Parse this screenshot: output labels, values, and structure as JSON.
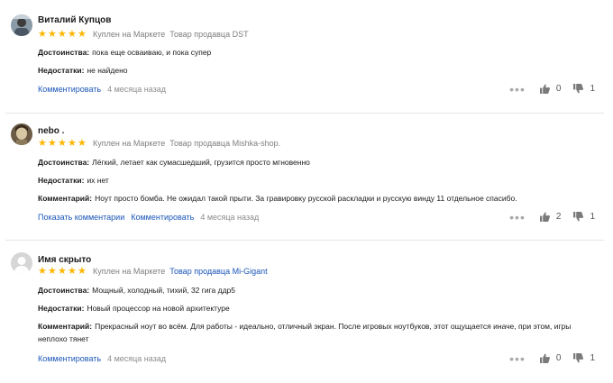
{
  "colors": {
    "star": "#fdb600",
    "link": "#1b56b8",
    "muted": "#8c8c8c"
  },
  "icons": {
    "more": "more-dots-icon",
    "like": "thumb-up-icon",
    "dislike": "thumb-down-icon",
    "rating": "star-icon"
  },
  "reviews": [
    {
      "author": "Виталий Купцов",
      "rating": 5,
      "purchase": "Куплен на Маркете",
      "seller": "Товар продавца DST",
      "pros_label": "Достоинства:",
      "pros": "пока еще осваиваю, и пока супер",
      "cons_label": "Недостатки:",
      "cons": "не найдено",
      "comment_action": "Комментировать",
      "date": "4 месяца назад",
      "likes": "0",
      "dislikes": "1"
    },
    {
      "author": "nebo .",
      "rating": 5,
      "purchase": "Куплен на Маркете",
      "seller": "Товар продавца Mishka-shop.",
      "pros_label": "Достоинства:",
      "pros": "Лёгкий, летает как сумасшедший, грузится просто мгновенно",
      "cons_label": "Недостатки:",
      "cons": "их нет",
      "comment_label": "Комментарий:",
      "comment": "Ноут просто бомба. Не ожидал такой прыти. За гравировку русской раскладки и русскую винду 11 отдельное спасибо.",
      "show_comments": "Показать комментарии",
      "comment_action": "Комментировать",
      "date": "4 месяца назад",
      "likes": "2",
      "dislikes": "1"
    },
    {
      "author": "Имя скрыто",
      "rating": 5,
      "purchase": "Куплен на Маркете",
      "seller": "Товар продавца Mi-Gigant",
      "pros_label": "Достоинства:",
      "pros": "Мощный, холодный, тихий, 32 гига ддр5",
      "cons_label": "Недостатки:",
      "cons": "Новый процессор на новой архитектуре",
      "comment_label": "Комментарий:",
      "comment": "Прекрасный ноут во всём. Для работы - идеально, отличный экран. После игровых ноутбуков, этот ощущается иначе, при этом, игры неплохо тянет",
      "comment_action": "Комментировать",
      "date": "4 месяца назад",
      "likes": "0",
      "dislikes": "1"
    }
  ]
}
